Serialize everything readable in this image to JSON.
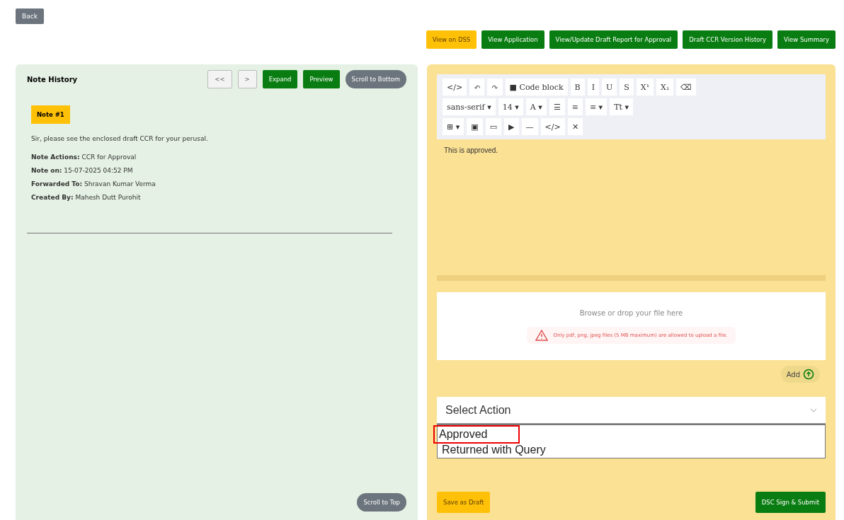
{
  "back_button": "Back",
  "top_buttons": [
    {
      "label": "View on DSS",
      "kind": "warning"
    },
    {
      "label": "View Application",
      "kind": "primary"
    },
    {
      "label": "View/Update Draft Report for Approval",
      "kind": "primary"
    },
    {
      "label": "Draft CCR Version History",
      "kind": "primary"
    },
    {
      "label": "View Summary",
      "kind": "primary"
    }
  ],
  "note_history": {
    "title": "Note History",
    "controls": [
      {
        "label": "<<",
        "kind": "outline"
      },
      {
        "label": ">",
        "kind": "outline"
      },
      {
        "label": "Expand",
        "kind": "primary"
      },
      {
        "label": "Preview",
        "kind": "primary"
      },
      {
        "label": "Scroll to Bottom",
        "kind": "pill"
      }
    ],
    "notes": [
      {
        "badge": "Note #1",
        "message": "Sir, please see the enclosed draft CCR for your perusal.",
        "fields": [
          {
            "label": "Note Actions:",
            "value": "CCR for Approval"
          },
          {
            "label": "Note on:",
            "value": "15-07-2025 04:52 PM"
          },
          {
            "label": "Forwarded To:",
            "value": "Shravan Kumar Verma"
          },
          {
            "label": "Created By:",
            "value": "Mahesh Dutt Purohit"
          }
        ]
      }
    ],
    "scroll_top_button": "Scroll to Top"
  },
  "editor": {
    "toolbar": [
      [
        {
          "label": "</>"
        },
        {
          "label": "↶"
        },
        {
          "label": "↷"
        },
        {
          "label": "■ Code block"
        },
        {
          "label": "B"
        },
        {
          "label": "I"
        },
        {
          "label": "U"
        },
        {
          "label": "S"
        },
        {
          "label": "X¹"
        },
        {
          "label": "X₁"
        },
        {
          "label": "⌫"
        }
      ],
      [
        {
          "label": "sans-serif ▾"
        },
        {
          "label": "14 ▾"
        },
        {
          "label": "A ▾"
        },
        {
          "label": "☰"
        },
        {
          "label": "≡"
        },
        {
          "label": "≡ ▾"
        },
        {
          "label": "Tt ▾"
        }
      ],
      [
        {
          "label": "⊞ ▾"
        },
        {
          "label": "▣"
        },
        {
          "label": "▭"
        },
        {
          "label": "▶"
        },
        {
          "label": "—"
        },
        {
          "label": "</>"
        },
        {
          "label": "✕"
        }
      ]
    ],
    "content": "This is approved."
  },
  "upload": {
    "prompt": "Browse or drop your file here",
    "warning": "Only pdf, png, jpeg files (5 MB maximum) are allowed to upload a file."
  },
  "add_button": "Add",
  "action_select": {
    "placeholder": "Select Action",
    "options": [
      {
        "label": "Approved",
        "highlighted": true
      },
      {
        "label": "Returned with Query",
        "highlighted": false
      }
    ]
  },
  "footer_buttons": [
    {
      "label": "Save as Draft",
      "kind": "warning"
    },
    {
      "label": "DSC Sign & Submit",
      "kind": "primary"
    }
  ]
}
